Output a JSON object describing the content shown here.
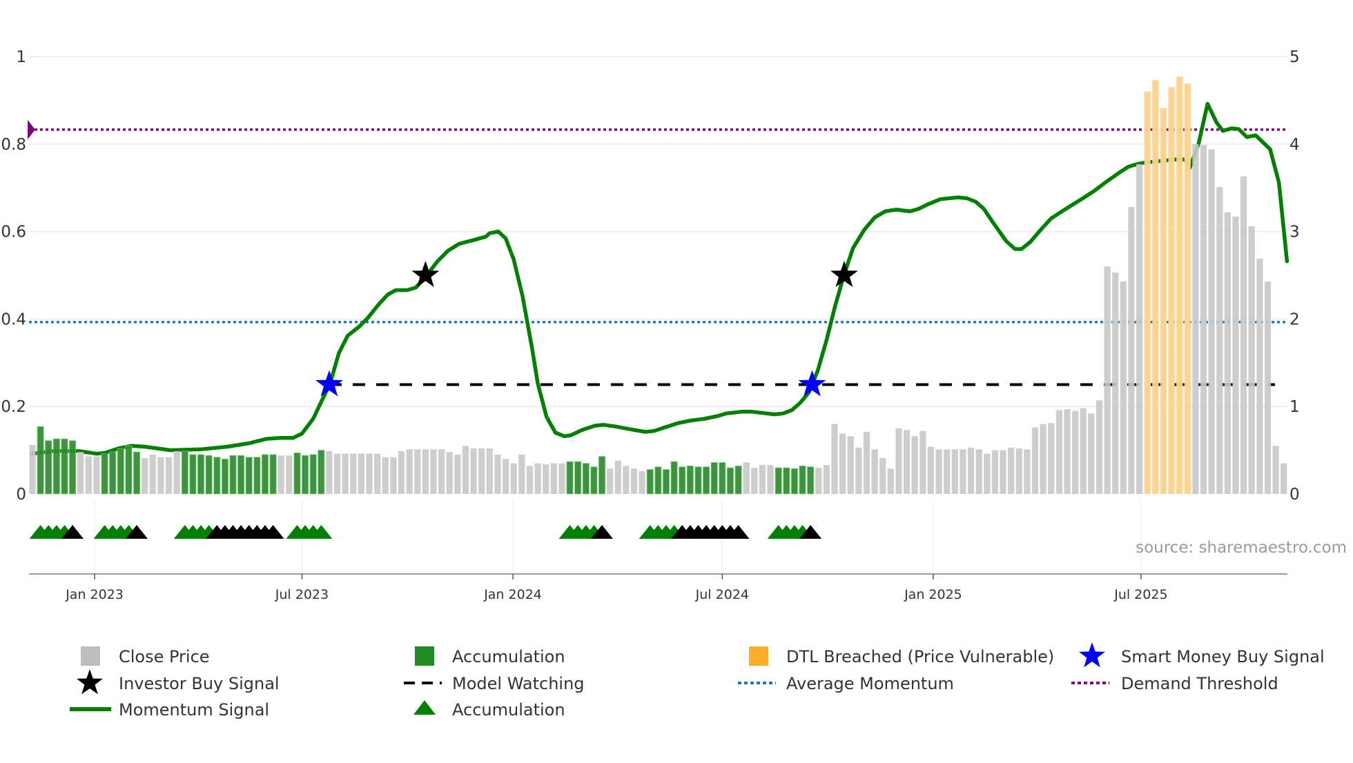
{
  "chart_data": {
    "type": "bar+line",
    "x_unit": "week index",
    "left_axis": {
      "ticks": [
        "0",
        "0.2",
        "0.4",
        "0.6",
        "0.8",
        "1"
      ],
      "tick_values": [
        0,
        0.2,
        0.4,
        0.6,
        0.8,
        1
      ],
      "ylim": [
        0,
        1
      ]
    },
    "right_axis": {
      "ticks": [
        "0",
        "1",
        "2",
        "3",
        "4",
        "5"
      ],
      "tick_values": [
        0,
        1,
        2,
        3,
        4,
        5
      ],
      "ylim": [
        0,
        5
      ]
    },
    "x_ticks": [
      {
        "label": "Jan 2023",
        "week": 7.75
      },
      {
        "label": "Jul 2023",
        "week": 33.6
      },
      {
        "label": "Jan 2024",
        "week": 59.9
      },
      {
        "label": "Jul 2024",
        "week": 86.0
      },
      {
        "label": "Jan 2025",
        "week": 112.3
      },
      {
        "label": "Jul 2025",
        "week": 138.2
      }
    ],
    "close_price": [
      0.56,
      0.77,
      0.61,
      0.63,
      0.63,
      0.61,
      0.48,
      0.43,
      0.43,
      0.46,
      0.48,
      0.52,
      0.55,
      0.48,
      0.41,
      0.45,
      0.42,
      0.42,
      0.49,
      0.49,
      0.45,
      0.45,
      0.44,
      0.42,
      0.4,
      0.44,
      0.44,
      0.42,
      0.42,
      0.45,
      0.45,
      0.44,
      0.44,
      0.47,
      0.44,
      0.45,
      0.5,
      0.49,
      0.46,
      0.46,
      0.46,
      0.46,
      0.46,
      0.46,
      0.42,
      0.42,
      0.49,
      0.51,
      0.51,
      0.51,
      0.51,
      0.51,
      0.48,
      0.45,
      0.55,
      0.52,
      0.52,
      0.52,
      0.45,
      0.4,
      0.35,
      0.45,
      0.32,
      0.35,
      0.34,
      0.35,
      0.35,
      0.37,
      0.37,
      0.35,
      0.31,
      0.43,
      0.29,
      0.38,
      0.32,
      0.29,
      0.26,
      0.28,
      0.31,
      0.28,
      0.37,
      0.31,
      0.32,
      0.31,
      0.31,
      0.36,
      0.36,
      0.3,
      0.32,
      0.36,
      0.3,
      0.33,
      0.33,
      0.3,
      0.3,
      0.29,
      0.32,
      0.31,
      0.3,
      0.33,
      0.8,
      0.69,
      0.66,
      0.53,
      0.71,
      0.51,
      0.41,
      0.29,
      0.75,
      0.73,
      0.66,
      0.72,
      0.54,
      0.51,
      0.51,
      0.51,
      0.51,
      0.53,
      0.51,
      0.46,
      0.5,
      0.5,
      0.53,
      0.52,
      0.51,
      0.76,
      0.8,
      0.81,
      0.96,
      0.97,
      0.95,
      0.98,
      0.92,
      1.07,
      2.6,
      2.53,
      2.43,
      3.28,
      3.77,
      4.6,
      4.73,
      4.41,
      4.65,
      4.77,
      4.69,
      4.0,
      3.99,
      3.94,
      3.51,
      3.22,
      3.17,
      3.63,
      3.06,
      2.69,
      2.43,
      0.55,
      0.35
    ],
    "accumulation_weeks": [
      [
        1,
        5
      ],
      [
        9,
        13
      ],
      [
        19,
        30
      ],
      [
        33,
        36
      ],
      [
        67,
        71
      ],
      [
        77,
        88
      ],
      [
        93,
        97
      ]
    ],
    "dtl_breached_weeks": [
      [
        139,
        144
      ]
    ],
    "accumulation_markers": [
      {
        "green": [
          1,
          4
        ],
        "black": [
          5,
          5
        ]
      },
      {
        "green": [
          9,
          12
        ],
        "black": [
          13,
          13
        ]
      },
      {
        "green": [
          19,
          22
        ],
        "black": [
          23,
          30
        ]
      },
      {
        "green": [
          33,
          36
        ]
      },
      {
        "green": [
          67,
          70
        ],
        "black": [
          71,
          71
        ]
      },
      {
        "green": [
          77,
          80
        ],
        "black": [
          81,
          88
        ]
      },
      {
        "green": [
          93,
          96
        ],
        "black": [
          97,
          97
        ]
      }
    ],
    "momentum": [
      [
        0,
        0.092
      ],
      [
        2.5,
        0.098
      ],
      [
        5.8,
        0.098
      ],
      [
        8.0,
        0.092
      ],
      [
        9.1,
        0.094
      ],
      [
        10.7,
        0.104
      ],
      [
        12.3,
        0.11
      ],
      [
        14.0,
        0.108
      ],
      [
        17.2,
        0.1
      ],
      [
        21.0,
        0.102
      ],
      [
        24.3,
        0.108
      ],
      [
        27.0,
        0.116
      ],
      [
        29.2,
        0.126
      ],
      [
        30.9,
        0.128
      ],
      [
        32.5,
        0.128
      ],
      [
        33.6,
        0.138
      ],
      [
        35.0,
        0.172
      ],
      [
        36.3,
        0.222
      ],
      [
        37.1,
        0.252
      ],
      [
        38.2,
        0.322
      ],
      [
        39.3,
        0.362
      ],
      [
        40.7,
        0.382
      ],
      [
        41.8,
        0.402
      ],
      [
        43.1,
        0.432
      ],
      [
        44.3,
        0.456
      ],
      [
        45.3,
        0.466
      ],
      [
        46.7,
        0.466
      ],
      [
        47.8,
        0.472
      ],
      [
        49.0,
        0.496
      ],
      [
        50.5,
        0.532
      ],
      [
        51.8,
        0.556
      ],
      [
        53.2,
        0.572
      ],
      [
        54.9,
        0.58
      ],
      [
        56.5,
        0.588
      ],
      [
        57.0,
        0.596
      ],
      [
        58.1,
        0.6
      ],
      [
        59.0,
        0.584
      ],
      [
        60.0,
        0.536
      ],
      [
        61.1,
        0.452
      ],
      [
        62.3,
        0.332
      ],
      [
        63.0,
        0.252
      ],
      [
        64.1,
        0.176
      ],
      [
        65.2,
        0.14
      ],
      [
        66.3,
        0.132
      ],
      [
        67.1,
        0.134
      ],
      [
        68.5,
        0.146
      ],
      [
        70.1,
        0.156
      ],
      [
        71.2,
        0.158
      ],
      [
        72.8,
        0.154
      ],
      [
        74.5,
        0.148
      ],
      [
        76.4,
        0.142
      ],
      [
        77.5,
        0.144
      ],
      [
        78.8,
        0.152
      ],
      [
        80.5,
        0.162
      ],
      [
        82.1,
        0.168
      ],
      [
        83.8,
        0.172
      ],
      [
        85.4,
        0.178
      ],
      [
        86.5,
        0.184
      ],
      [
        88.4,
        0.188
      ],
      [
        89.7,
        0.188
      ],
      [
        92.5,
        0.182
      ],
      [
        93.6,
        0.184
      ],
      [
        94.7,
        0.192
      ],
      [
        95.7,
        0.208
      ],
      [
        96.8,
        0.232
      ],
      [
        97.9,
        0.282
      ],
      [
        99.0,
        0.352
      ],
      [
        100.1,
        0.432
      ],
      [
        101.2,
        0.502
      ],
      [
        102.3,
        0.562
      ],
      [
        103.7,
        0.604
      ],
      [
        105.0,
        0.632
      ],
      [
        106.3,
        0.646
      ],
      [
        107.7,
        0.65
      ],
      [
        109.4,
        0.646
      ],
      [
        110.5,
        0.652
      ],
      [
        111.6,
        0.662
      ],
      [
        113.2,
        0.674
      ],
      [
        115.4,
        0.678
      ],
      [
        116.5,
        0.676
      ],
      [
        117.6,
        0.668
      ],
      [
        118.6,
        0.652
      ],
      [
        119.7,
        0.622
      ],
      [
        121.4,
        0.578
      ],
      [
        122.5,
        0.56
      ],
      [
        123.3,
        0.56
      ],
      [
        124.4,
        0.576
      ],
      [
        125.7,
        0.604
      ],
      [
        127.0,
        0.63
      ],
      [
        128.5,
        0.648
      ],
      [
        130.6,
        0.672
      ],
      [
        132.3,
        0.692
      ],
      [
        133.9,
        0.714
      ],
      [
        135.6,
        0.736
      ],
      [
        136.6,
        0.748
      ],
      [
        137.7,
        0.754
      ],
      [
        138.8,
        0.758
      ],
      [
        141.0,
        0.762
      ],
      [
        143.2,
        0.766
      ],
      [
        143.7,
        0.764
      ],
      [
        144.3,
        0.746
      ],
      [
        145.4,
        0.802
      ],
      [
        146.5,
        0.892
      ],
      [
        147.6,
        0.85
      ],
      [
        148.4,
        0.83
      ],
      [
        149.5,
        0.836
      ],
      [
        150.4,
        0.834
      ],
      [
        151.4,
        0.816
      ],
      [
        152.5,
        0.82
      ],
      [
        154.3,
        0.788
      ],
      [
        155.4,
        0.712
      ],
      [
        156.4,
        0.532
      ]
    ],
    "smart_money_buy_signals": [
      [
        37.0,
        0.25
      ],
      [
        97.2,
        0.25
      ]
    ],
    "investor_buy_signals": [
      [
        49.0,
        0.5
      ],
      [
        101.2,
        0.5
      ]
    ],
    "model_watching": {
      "from_week": 37.0,
      "to_week": 154.9,
      "value": 0.25
    },
    "average_momentum": 0.393,
    "demand_threshold": 0.833,
    "legend": [
      "Close Price",
      "Accumulation",
      "DTL Breached (Price Vulnerable)",
      "Smart Money Buy Signal",
      "Investor Buy Signal",
      "Model Watching",
      "Average Momentum",
      "Demand Threshold",
      "Momentum Signal",
      "Accumulation"
    ],
    "legend_placement": "bottom",
    "annotation": "source: sharemaestro.com",
    "colors": {
      "close_price": "#c8c8c8",
      "accumulation": "#2e8b2e",
      "dtl": "#ffd28a",
      "dtl_legend": "#ffae2a",
      "momentum": "#008000",
      "average_momentum": "#1f77b4",
      "demand_threshold": "#800080",
      "smart_money": "#0000ff",
      "investor": "#000000"
    }
  }
}
